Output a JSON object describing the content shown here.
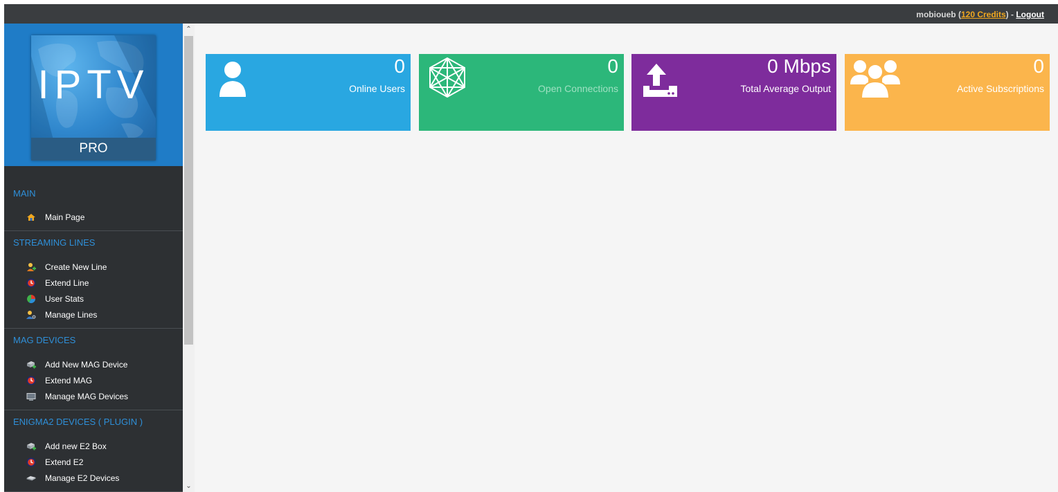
{
  "topbar": {
    "username": "mobioueb",
    "credits_open": " (",
    "credits_label": "120 Credits",
    "credits_close": ") - ",
    "logout_label": "Logout"
  },
  "logo": {
    "title": "IPTV",
    "subtitle": "PRO"
  },
  "sidebar": {
    "sections": [
      {
        "title": "MAIN",
        "items": [
          {
            "label": "Main Page",
            "icon": "home-icon"
          }
        ]
      },
      {
        "title": "STREAMING LINES",
        "items": [
          {
            "label": "Create New Line",
            "icon": "add-user-icon"
          },
          {
            "label": "Extend Line",
            "icon": "clock-icon"
          },
          {
            "label": "User Stats",
            "icon": "pie-chart-icon"
          },
          {
            "label": "Manage Lines",
            "icon": "user-gear-icon"
          }
        ]
      },
      {
        "title": "MAG DEVICES",
        "items": [
          {
            "label": "Add New MAG Device",
            "icon": "add-device-icon"
          },
          {
            "label": "Extend MAG",
            "icon": "clock-icon"
          },
          {
            "label": "Manage MAG Devices",
            "icon": "monitor-icon"
          }
        ]
      },
      {
        "title": "ENIGMA2 DEVICES ( PLUGIN )",
        "items": [
          {
            "label": "Add new E2 Box",
            "icon": "add-device-icon"
          },
          {
            "label": "Extend E2",
            "icon": "clock-icon"
          },
          {
            "label": "Manage E2 Devices",
            "icon": "device-icon"
          }
        ]
      }
    ]
  },
  "tiles": [
    {
      "value": "0",
      "label": "Online Users",
      "color": "#29a7e1",
      "icon": "user-icon"
    },
    {
      "value": "0",
      "label": "Open Connections",
      "color": "#2cb77a",
      "icon": "network-icon"
    },
    {
      "value": "0 Mbps",
      "label": "Total Average Output",
      "color": "#7e2c9c",
      "icon": "upload-icon"
    },
    {
      "value": "0",
      "label": "Active Subscriptions",
      "color": "#fbb54c",
      "icon": "users-group-icon"
    }
  ]
}
